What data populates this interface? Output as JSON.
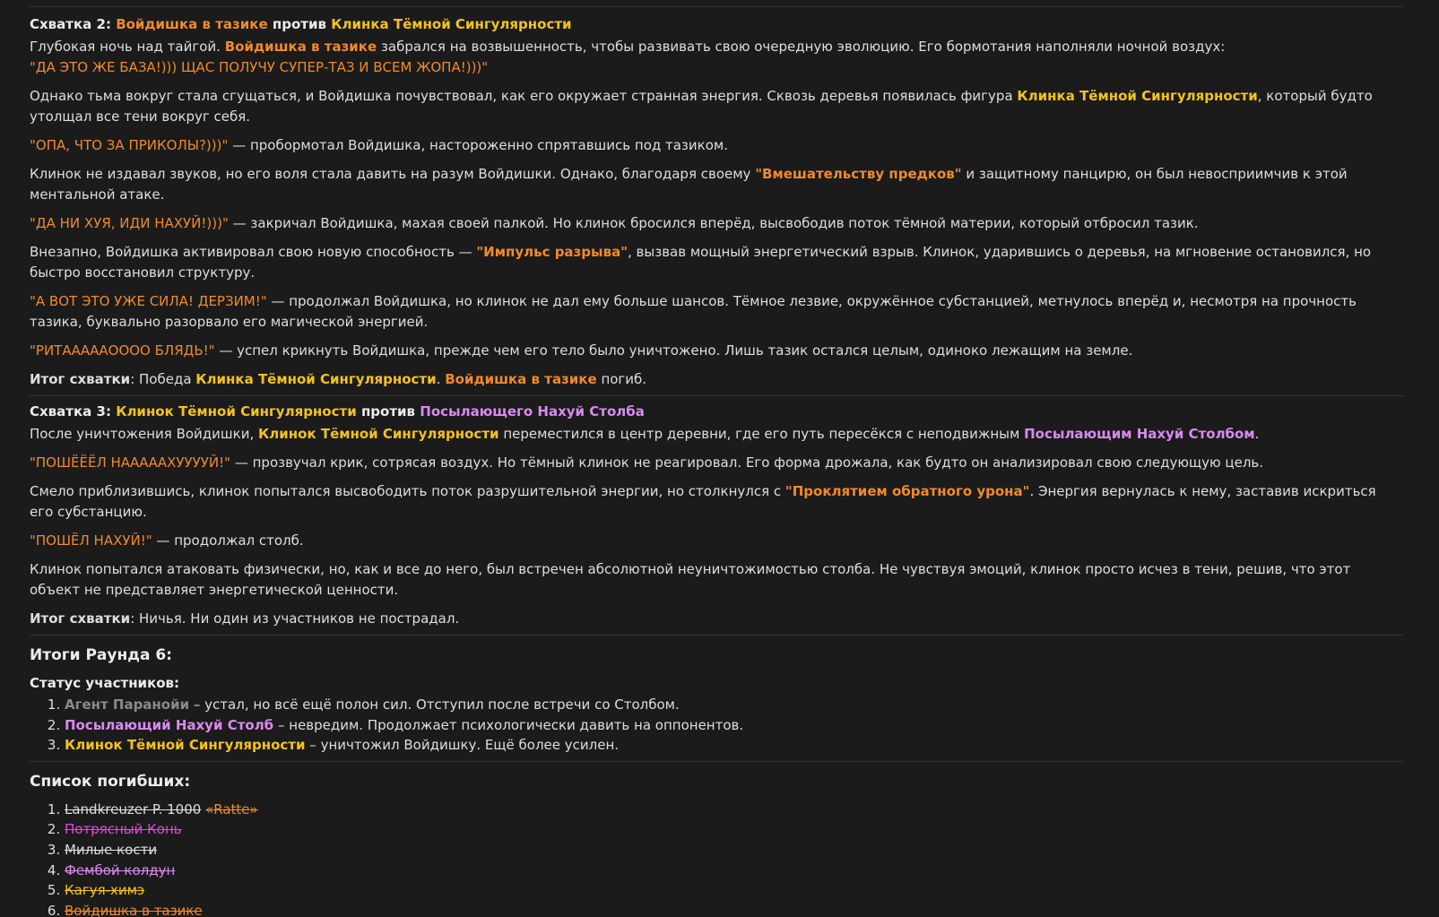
{
  "fight2": {
    "heading_prefix": "Схватка 2:",
    "fighter_a": "Войдишка в тазике",
    "vs": "против",
    "fighter_b": "Клинка Тёмной Сингулярности",
    "p1_a": "Глубокая ночь над тайгой.",
    "p1_name": "Войдишка в тазике",
    "p1_b": "забрался на возвышенность, чтобы развивать свою очередную эволюцию. Его бормотания наполняли ночной воздух:",
    "p1_quote": "\"ДА ЭТО ЖЕ БАЗА!))) ЩАС ПОЛУЧУ СУПЕР-ТАЗ И ВСЕМ ЖОПА!)))\"",
    "p2_a": "Однако тьма вокруг стала сгущаться, и Войдишка почувствовал, как его окружает странная энергия. Сквозь деревья появилась фигура",
    "p2_name": "Клинка Тёмной Сингулярности",
    "p2_b": ", который будто утолщал все тени вокруг себя.",
    "p3_quote": "\"ОПА, ЧТО ЗА ПРИКОЛЫ?)))\"",
    "p3_rest": "— пробормотал Войдишка, настороженно спрятавшись под тазиком.",
    "p4_a": "Клинок не издавал звуков, но его воля стала давить на разум Войдишки. Однако, благодаря своему",
    "p4_term": "\"Вмешательству предков\"",
    "p4_b": "и защитному панцирю, он был невосприимчив к этой ментальной атаке.",
    "p5_quote": "\"ДА НИ ХУЯ, ИДИ НАХУЙ!)))\"",
    "p5_rest": "— закричал Войдишка, махая своей палкой. Но клинок бросился вперёд, высвободив поток тёмной материи, который отбросил тазик.",
    "p6_a": "Внезапно, Войдишка активировал свою новую способность —",
    "p6_term": "\"Импульс разрыва\"",
    "p6_b": ", вызвав мощный энергетический взрыв. Клинок, ударившись о деревья, на мгновение остановился, но быстро восстановил структуру.",
    "p7_quote": "\"А ВОТ ЭТО УЖЕ СИЛА! ДЕРЗИМ!\"",
    "p7_rest": "— продолжал Войдишка, но клинок не дал ему больше шансов. Тёмное лезвие, окружённое субстанцией, метнулось вперёд и, несмотря на прочность тазика, буквально разорвало его магической энергией.",
    "p8_quote": "\"РИТАААААОООО БЛЯДЬ!\"",
    "p8_rest": "— успел крикнуть Войдишка, прежде чем его тело было уничтожено. Лишь тазик остался целым, одиноко лежащим на земле.",
    "result_label": "Итог схватки",
    "result_a": ": Победа",
    "result_winner": "Клинка Тёмной Сингулярности",
    "result_dot": ".",
    "result_loser": "Войдишка в тазике",
    "result_b": "погиб."
  },
  "fight3": {
    "heading_prefix": "Схватка 3:",
    "fighter_a": "Клинок Тёмной Сингулярности",
    "vs": "против",
    "fighter_b": "Посылающего Нахуй Столба",
    "p1_a": "После уничтожения Войдишки,",
    "p1_name": "Клинок Тёмной Сингулярности",
    "p1_b": "переместился в центр деревни, где его путь пересёкся с неподвижным",
    "p1_name2": "Посылающим Нахуй Столбом",
    "p1_c": ".",
    "p2_quote": "\"ПОШЁЁЁЛ НАААААХУУУУЙ!\"",
    "p2_rest": "— прозвучал крик, сотрясая воздух. Но тёмный клинок не реагировал. Его форма дрожала, как будто он анализировал свою следующую цель.",
    "p3_a": "Смело приблизившись, клинок попытался высвободить поток разрушительной энергии, но столкнулся с",
    "p3_term": "\"Проклятием обратного урона\"",
    "p3_b": ". Энергия вернулась к нему, заставив искриться его субстанцию.",
    "p4_quote": "\"ПОШЁЛ НАХУЙ!\"",
    "p4_rest": "— продолжал столб.",
    "p5": "Клинок попытался атаковать физически, но, как и все до него, был встречен абсолютной неуничтожимостью столба. Не чувствуя эмоций, клинок просто исчез в тени, решив, что этот объект не представляет энергетической ценности.",
    "result_label": "Итог схватки",
    "result_text": ": Ничья. Ни один из участников не пострадал."
  },
  "summary": {
    "title": "Итоги Раунда 6:",
    "status_title": "Статус участников:",
    "status": [
      {
        "name": "Агент Паранойи",
        "text": "– устал, но всё ещё полон сил. Отступил после встречи со Столбом."
      },
      {
        "name": "Посылающий Нахуй Столб",
        "text": "– невредим. Продолжает психологически давить на оппонентов."
      },
      {
        "name": "Клинок Тёмной Сингулярности",
        "text": "– уничтожил Войдишку. Ещё более усилен."
      }
    ],
    "dead_title": "Список погибших:",
    "dead": [
      {
        "main": "Landkreuzer P. 1000",
        "accent": "«Ratte»"
      },
      {
        "main": "Потрясный Конь"
      },
      {
        "main": "Милые кости"
      },
      {
        "main": "Фембой колдун"
      },
      {
        "main": "Кагуя-химэ"
      },
      {
        "main": "Войдишка в тазике"
      }
    ]
  }
}
